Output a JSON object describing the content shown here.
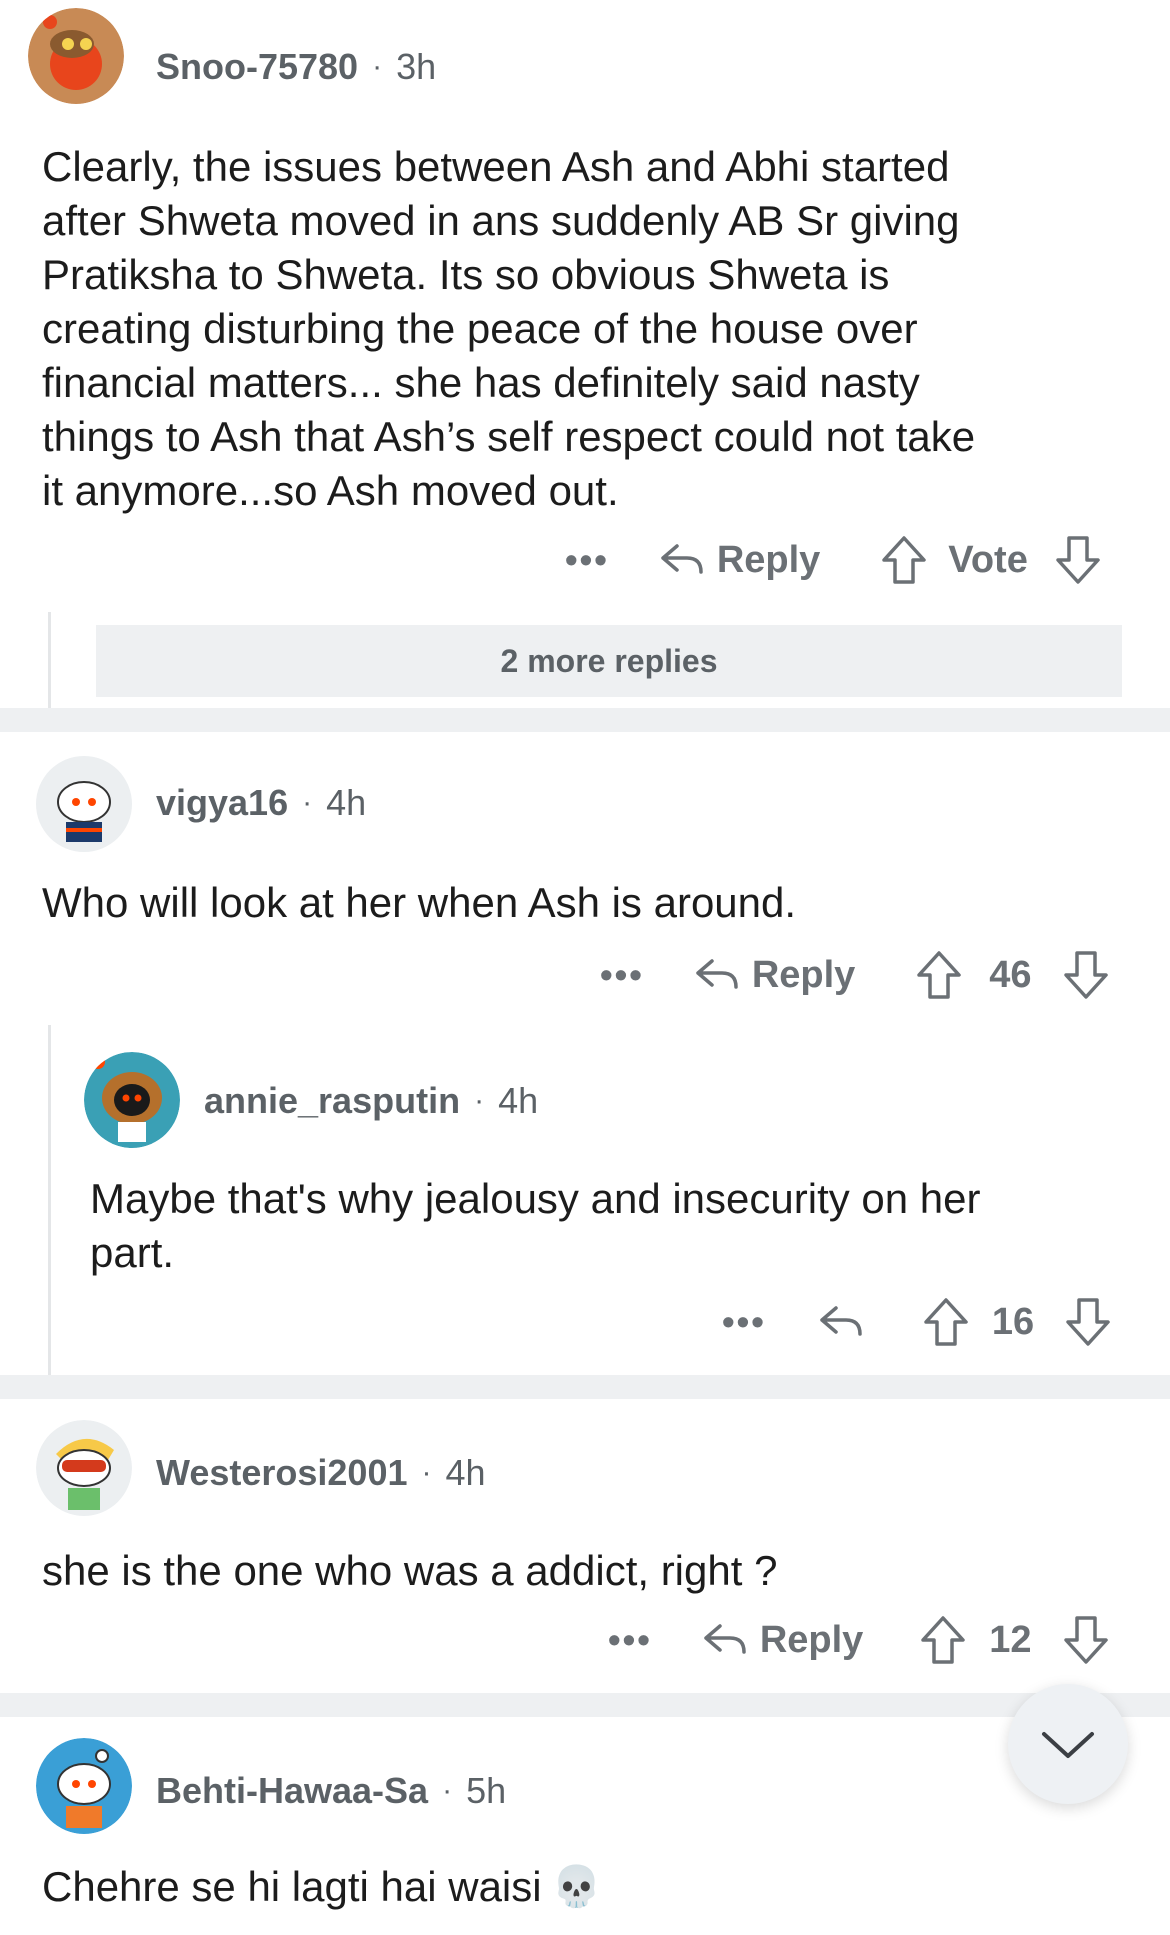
{
  "comments": [
    {
      "user": "Snoo-75780",
      "sep": "·",
      "time": "3h",
      "lines": [
        "Clearly, the issues between Ash and Abhi started",
        "after Shweta moved in ans suddenly AB Sr giving",
        "Pratiksha to Shweta. Its so obvious Shweta is",
        "creating disturbing the peace of the house over",
        "financial matters... she has definitely said nasty",
        "things to Ash that Ash’s self respect could not take",
        "it anymore...so Ash moved out."
      ],
      "more": "•••",
      "reply_label": "Reply",
      "vote_label": "Vote",
      "more_replies": "2 more replies"
    },
    {
      "user": "vigya16",
      "sep": "·",
      "time": "4h",
      "lines": [
        "Who will look at her when Ash is around."
      ],
      "more": "•••",
      "reply_label": "Reply",
      "vote_label": "46"
    },
    {
      "user": "annie_rasputin",
      "sep": "·",
      "time": "4h",
      "lines": [
        "Maybe that's why jealousy and insecurity on her",
        "part."
      ],
      "more": "•••",
      "vote_label": "16"
    },
    {
      "user": "Westerosi2001",
      "sep": "·",
      "time": "4h",
      "lines": [
        "she is the one who was a addict, right ?"
      ],
      "more": "•••",
      "reply_label": "Reply",
      "vote_label": "12"
    },
    {
      "user": "Behti-Hawaa-Sa",
      "sep": "·",
      "time": "5h",
      "lines": [
        "Chehre se hi lagti hai waisi"
      ],
      "emoji": "💀"
    }
  ],
  "icons": {
    "reply": "reply-arrow-icon",
    "upvote": "upvote-arrow-icon",
    "downvote": "downvote-arrow-icon",
    "collapse": "chevron-down-icon"
  },
  "colors": {
    "separator": "#eef0f2",
    "meta": "#5b6166",
    "action": "#6b7075"
  }
}
